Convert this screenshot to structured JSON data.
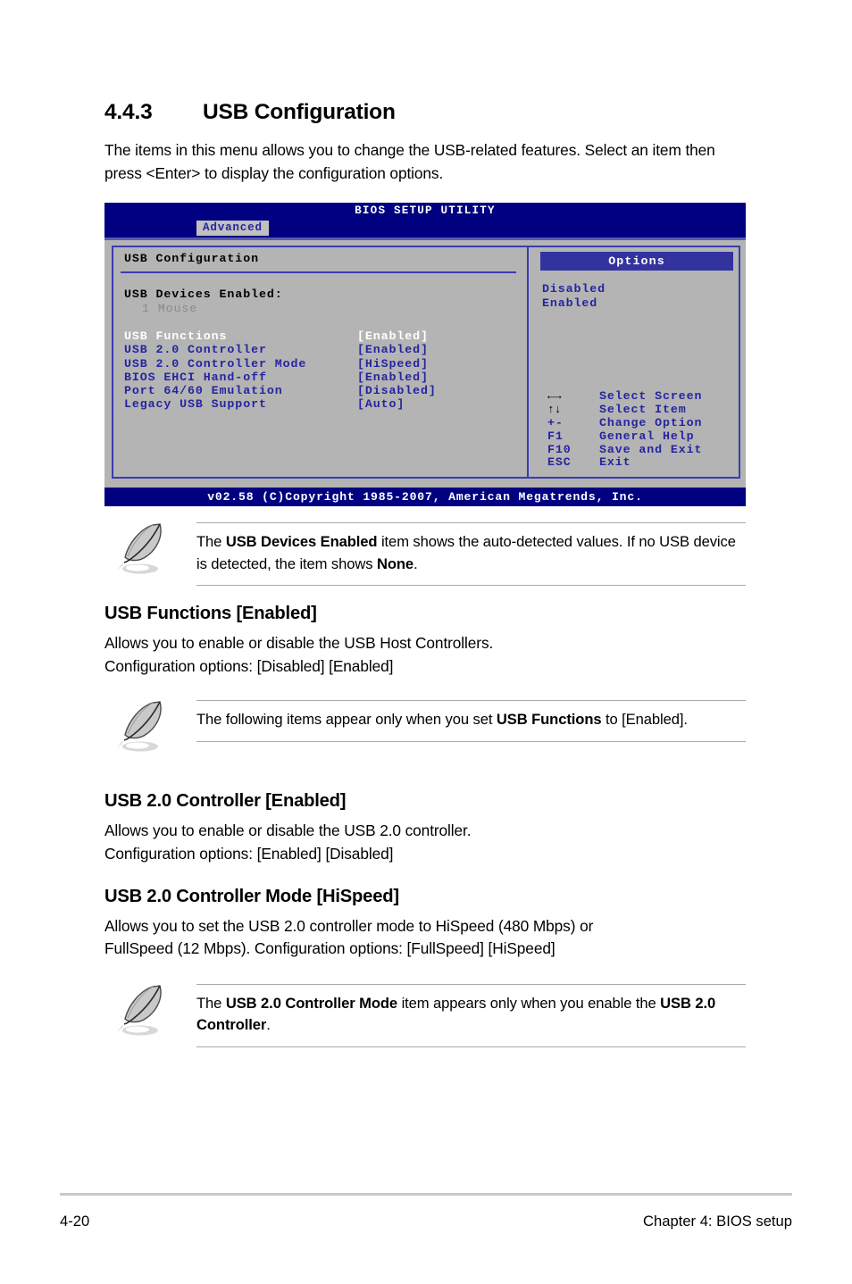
{
  "section": {
    "number": "4.4.3",
    "title": "USB Configuration",
    "intro": "The items in this menu allows you to change the USB-related features. Select an item then press <Enter> to display the configuration options."
  },
  "bios": {
    "title": "BIOS SETUP UTILITY",
    "active_tab": "Advanced",
    "panel_title": "USB Configuration",
    "devices_label": "USB Devices Enabled:",
    "devices_value": "1 Mouse",
    "items": [
      {
        "label": "USB Functions",
        "value": "[Enabled]",
        "selected": true
      },
      {
        "label": "USB 2.0 Controller",
        "value": "[Enabled]",
        "selected": false
      },
      {
        "label": "USB 2.0 Controller Mode",
        "value": "[HiSpeed]",
        "selected": false
      },
      {
        "label": "BIOS EHCI Hand-off",
        "value": "[Enabled]",
        "selected": false
      },
      {
        "label": "Port 64/60 Emulation",
        "value": "[Disabled]",
        "selected": false
      },
      {
        "label": "Legacy USB Support",
        "value": "[Auto]",
        "selected": false
      }
    ],
    "options_header": "Options",
    "options": [
      "Disabled",
      "Enabled"
    ],
    "nav": [
      {
        "key": "←→",
        "glyph": true,
        "desc": "Select Screen"
      },
      {
        "key": "↑↓",
        "glyph": true,
        "desc": "Select Item"
      },
      {
        "key": "+-",
        "glyph": false,
        "desc": "Change Option"
      },
      {
        "key": "F1",
        "glyph": false,
        "desc": "General Help"
      },
      {
        "key": "F10",
        "glyph": false,
        "desc": "Save and Exit"
      },
      {
        "key": "ESC",
        "glyph": false,
        "desc": "Exit"
      }
    ],
    "footer": "v02.58 (C)Copyright 1985-2007, American Megatrends, Inc.",
    "colors": {
      "header_bg": "#000080",
      "panel_bg": "#b4b4b4",
      "border": "#3b3bb0",
      "text_blue": "#2525a0",
      "options_header_bg": "#3333a0",
      "tab_bg": "#c0c0c0",
      "selected_text": "#ffffff",
      "device_value": "#8a8a8a"
    }
  },
  "notes": [
    {
      "id": "note-usb-devices-enabled",
      "parts": [
        {
          "t": "The ",
          "b": false
        },
        {
          "t": "USB Devices Enabled",
          "b": true
        },
        {
          "t": " item shows the auto-detected values. If no USB device is detected, the item shows ",
          "b": false
        },
        {
          "t": "None",
          "b": true
        },
        {
          "t": ".",
          "b": false
        }
      ]
    },
    {
      "id": "note-usb-functions-enabled",
      "parts": [
        {
          "t": "The following items appear only when you set ",
          "b": false
        },
        {
          "t": "USB Functions",
          "b": true
        },
        {
          "t": " to [Enabled].",
          "b": false
        }
      ]
    },
    {
      "id": "note-usb20-controller-mode",
      "parts": [
        {
          "t": "The ",
          "b": false
        },
        {
          "t": "USB 2.0 Controller Mode",
          "b": true
        },
        {
          "t": " item appears only when you enable the ",
          "b": false
        },
        {
          "t": "USB 2.0 Controller",
          "b": true
        },
        {
          "t": ".",
          "b": false
        }
      ]
    }
  ],
  "settings": [
    {
      "id": "usb-functions",
      "heading": "USB Functions [Enabled]",
      "line1": "Allows you to enable or disable the USB Host Controllers.",
      "line2": "Configuration options: [Disabled] [Enabled]"
    },
    {
      "id": "usb-20-controller",
      "heading": "USB 2.0 Controller [Enabled]",
      "line1": "Allows you to enable or disable the USB 2.0 controller.",
      "line2": "Configuration options: [Enabled] [Disabled]"
    },
    {
      "id": "usb-20-controller-mode",
      "heading": "USB 2.0 Controller Mode [HiSpeed]",
      "line1": "Allows you to set the USB 2.0 controller mode to HiSpeed (480 Mbps) or",
      "line2": "FullSpeed (12 Mbps). Configuration options: [FullSpeed] [HiSpeed]"
    }
  ],
  "page_footer": {
    "page_number": "4-20",
    "chapter": "Chapter 4: BIOS setup"
  }
}
